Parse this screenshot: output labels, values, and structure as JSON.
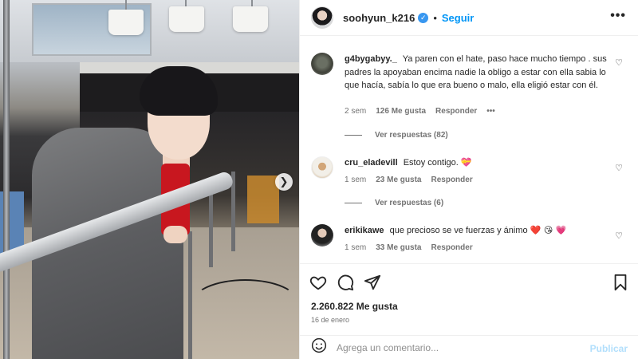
{
  "post": {
    "username": "soohyun_k216",
    "separator": "•",
    "follow_label": "Seguir",
    "likes": "2.260.822 Me gusta",
    "date": "16 de enero"
  },
  "comments": [
    {
      "user": "g4bygabyy._",
      "text": "Ya paren con el hate, paso hace mucho tiempo . sus padres la apoyaban encima nadie la obligo a estar con ella sabia lo que hacía, sabía lo que era bueno o malo, ella eligió estar con él.",
      "time": "2 sem",
      "likes": "126 Me gusta",
      "reply": "Responder",
      "more": "•••",
      "view_replies": "Ver respuestas (82)"
    },
    {
      "user": "cru_eladevill",
      "text": "Estoy contigo.",
      "emoji": "💝",
      "time": "1 sem",
      "likes": "23 Me gusta",
      "reply": "Responder",
      "view_replies": "Ver respuestas (6)"
    },
    {
      "user": "erikikawe",
      "text": "que precioso se ve fuerzas y ánimo",
      "emoji": "❤️ 😘 💗",
      "time": "1 sem",
      "likes": "33 Me gusta",
      "reply": "Responder"
    }
  ],
  "composer": {
    "placeholder": "Agrega un comentario...",
    "publish_label": "Publicar"
  },
  "icons": [
    "verified-icon",
    "more-options-icon",
    "heart-icon",
    "comment-icon",
    "share-icon",
    "bookmark-icon",
    "emoji-icon",
    "next-photo-icon"
  ],
  "colors": {
    "accent": "#0095f6",
    "text": "#262626",
    "secondary": "#737373",
    "verified": "#3897f0"
  }
}
